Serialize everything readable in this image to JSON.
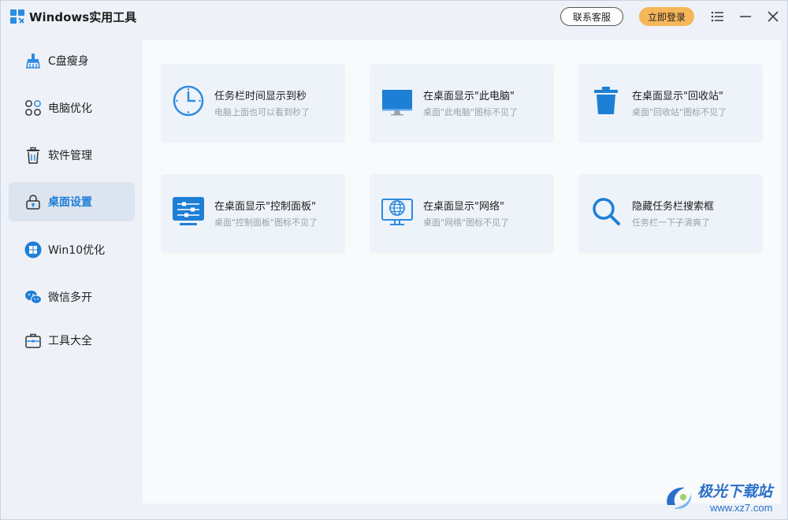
{
  "app": {
    "title": "Windows实用工具",
    "accent_color": "#1e7fd6",
    "login_color": "#f6b65a"
  },
  "header": {
    "service_label": "联系客服",
    "login_label": "立即登录",
    "icons": [
      "menu-icon",
      "minimize-icon",
      "close-icon"
    ]
  },
  "sidebar": {
    "active_index": 3,
    "items": [
      {
        "label": "C盘瘦身",
        "icon": "broom-icon"
      },
      {
        "label": "电脑优化",
        "icon": "grid-icon"
      },
      {
        "label": "软件管理",
        "icon": "trash-icon"
      },
      {
        "label": "桌面设置",
        "icon": "lock-icon"
      },
      {
        "label": "Win10优化",
        "icon": "windows-icon"
      },
      {
        "label": "微信多开",
        "icon": "wechat-icon"
      },
      {
        "label": "工具大全",
        "icon": "toolbox-icon"
      }
    ]
  },
  "cards": [
    {
      "title": "任务栏时间显示到秒",
      "desc": "电脑上面也可以看到秒了",
      "icon": "clock-icon"
    },
    {
      "title": "在桌面显示\"此电脑\"",
      "desc": "桌面\"此电脑\"图标不见了",
      "icon": "monitor-icon"
    },
    {
      "title": "在桌面显示\"回收站\"",
      "desc": "桌面\"回收站\"图标不见了",
      "icon": "recycle-bin-icon"
    },
    {
      "title": "在桌面显示\"控制面板\"",
      "desc": "桌面\"控制面板\"图标不见了",
      "icon": "control-panel-icon"
    },
    {
      "title": "在桌面显示\"网络\"",
      "desc": "桌面\"网络\"图标不见了",
      "icon": "network-icon"
    },
    {
      "title": "隐藏任务栏搜索框",
      "desc": "任务栏一下子清爽了",
      "icon": "search-icon"
    }
  ],
  "watermark": {
    "text": "极光下载站",
    "url": "www.xz7.com"
  }
}
